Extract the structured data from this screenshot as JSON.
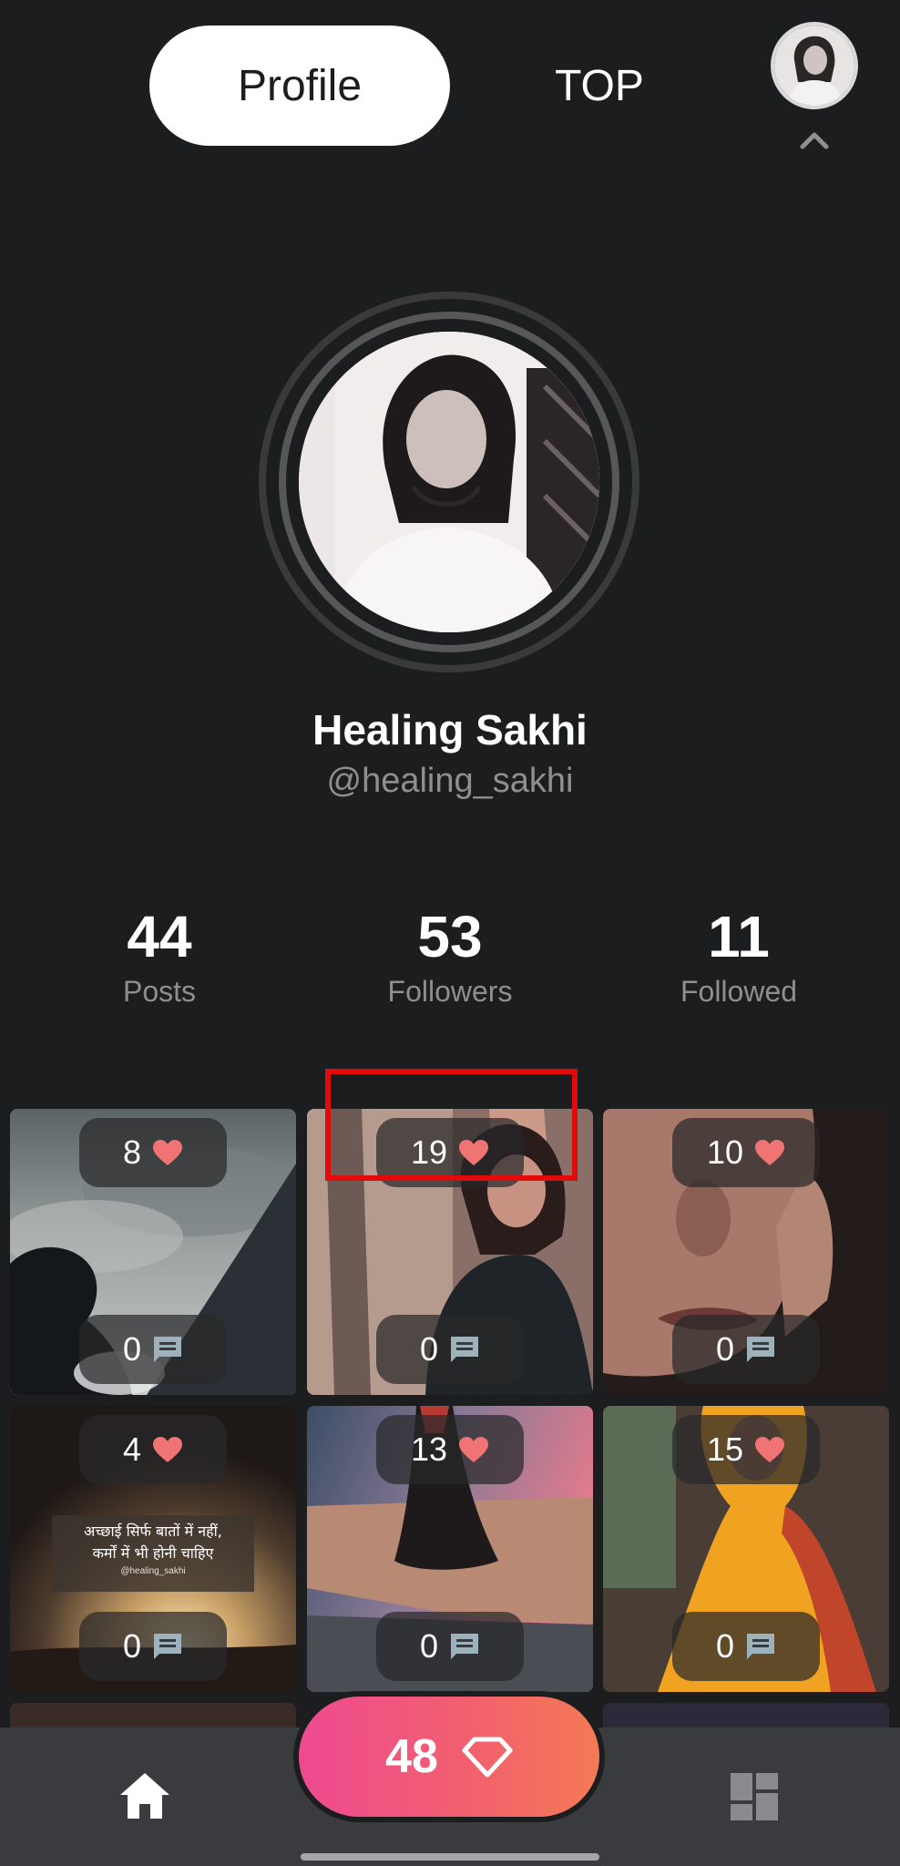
{
  "tabs": [
    {
      "label": "Profile",
      "active": true
    },
    {
      "label": "TOP",
      "active": false
    }
  ],
  "profile": {
    "name": "Healing Sakhi",
    "handle": "@healing_sakhi"
  },
  "stats": [
    {
      "value": "44",
      "label": "Posts"
    },
    {
      "value": "53",
      "label": "Followers"
    },
    {
      "value": "11",
      "label": "Followed"
    }
  ],
  "posts": [
    {
      "likes": "8",
      "comments": "0",
      "theme": "silhouette-clouds"
    },
    {
      "likes": "19",
      "comments": "0",
      "theme": "girl-black-jacket"
    },
    {
      "likes": "10",
      "comments": "0",
      "theme": "face-closeup"
    },
    {
      "likes": "4",
      "comments": "0",
      "theme": "sunset-quote",
      "quote_lines": [
        "अच्छाई सिर्फ बातों में नहीं,",
        "कर्मों में भी होनी चाहिए"
      ],
      "quote_handle": "@healing_sakhi"
    },
    {
      "likes": "13",
      "comments": "0",
      "theme": "dress-pink-sky"
    },
    {
      "likes": "15",
      "comments": "0",
      "theme": "yellow-lehenga"
    }
  ],
  "bottom_nav": {
    "diamond_count": "48"
  },
  "colors": {
    "background": "#1c1d1f",
    "heart": "#f07474",
    "highlight": "#e10b0b",
    "gradient_start": "#ee4a91",
    "gradient_end": "#f47a55"
  }
}
